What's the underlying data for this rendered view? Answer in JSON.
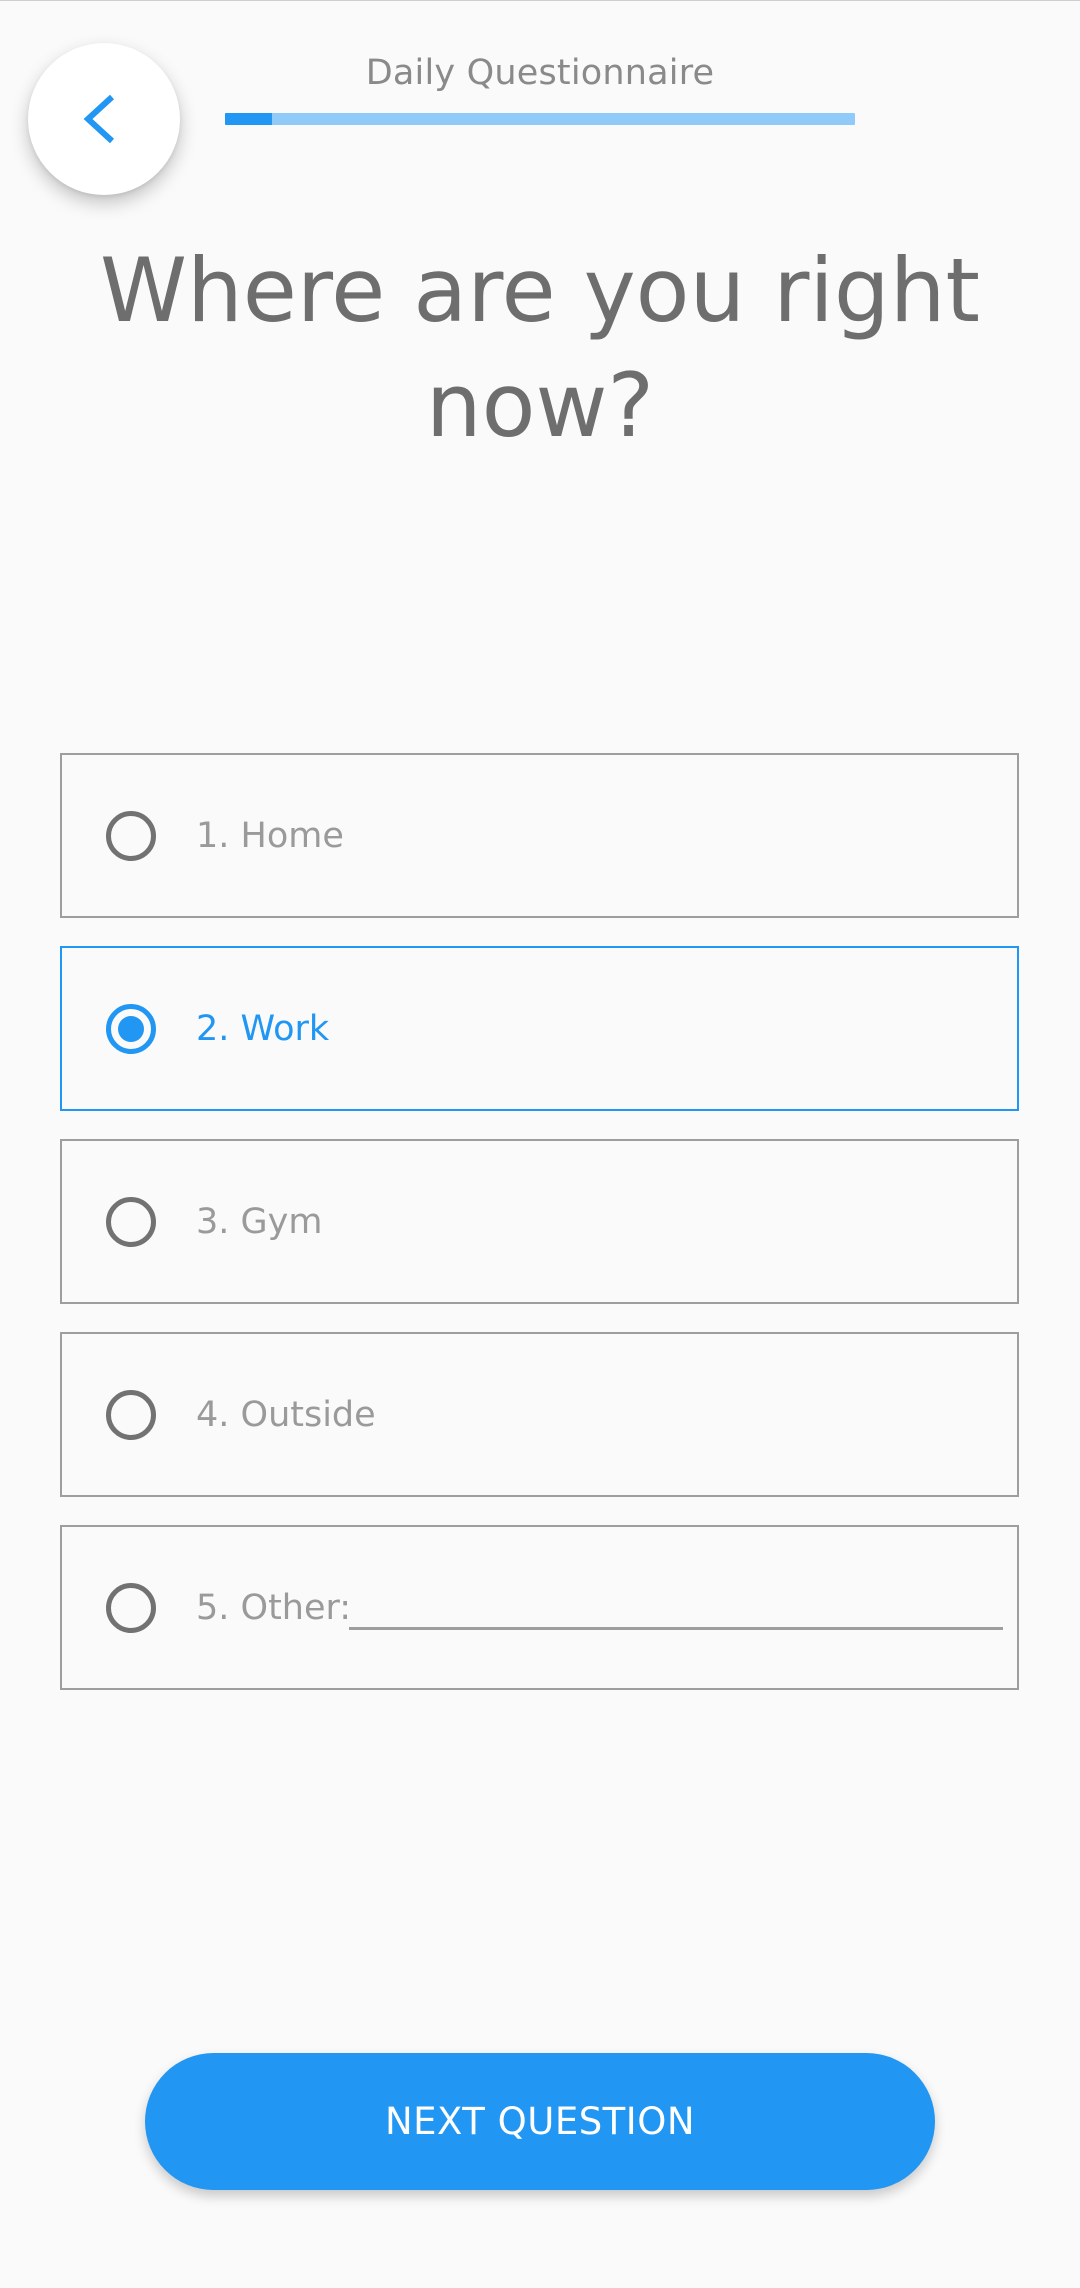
{
  "header": {
    "title": "Daily Questionnaire",
    "progress": 0.075,
    "back_icon": "chevron-left-icon"
  },
  "question": {
    "text": "Where are you right now?"
  },
  "options": [
    {
      "label": "1. Home",
      "selected": false
    },
    {
      "label": "2. Work",
      "selected": true
    },
    {
      "label": "3. Gym",
      "selected": false
    },
    {
      "label": "4. Outside",
      "selected": false
    },
    {
      "label": "5. Other:",
      "selected": false,
      "input_value": ""
    }
  ],
  "footer": {
    "next_label": "NEXT QUESTION"
  },
  "colors": {
    "accent": "#2196f3",
    "accent_light": "#90caf9",
    "text_muted": "#9a9a9a",
    "background": "#fafafa"
  }
}
